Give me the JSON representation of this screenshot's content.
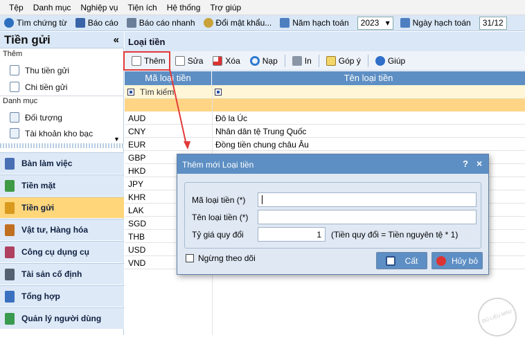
{
  "menu": [
    "Tệp",
    "Danh mục",
    "Nghiệp vụ",
    "Tiện ích",
    "Hệ thống",
    "Trợ giúp"
  ],
  "toolbar": {
    "items": [
      "Tìm chứng từ",
      "Báo cáo",
      "Báo cáo nhanh",
      "Đổi mật khẩu..."
    ],
    "year_label": "Năm hạch toán",
    "year_value": "2023",
    "date_label": "Ngày hạch toán",
    "date_value": "31/12"
  },
  "left": {
    "title": "Tiền gửi",
    "collapse": "«",
    "groups": [
      {
        "label": "Thêm",
        "items": [
          "Thu tiền gửi",
          "Chi tiền gửi"
        ]
      },
      {
        "label": "Danh mục",
        "items": [
          "Đối tượng",
          "Tài khoản kho bạc"
        ]
      }
    ],
    "modules": [
      {
        "label": "Bàn làm việc",
        "color": "#4a6fb5"
      },
      {
        "label": "Tiền mặt",
        "color": "#3f9a45"
      },
      {
        "label": "Tiền gửi",
        "color": "#d99a1e",
        "active": true
      },
      {
        "label": "Vật tư, Hàng hóa",
        "color": "#c07020"
      },
      {
        "label": "Công cụ dụng cụ",
        "color": "#b04060"
      },
      {
        "label": "Tài sản cố định",
        "color": "#556070"
      },
      {
        "label": "Tổng hợp",
        "color": "#3a70c0"
      },
      {
        "label": "Quản lý người dùng",
        "color": "#3a9a50"
      }
    ]
  },
  "main": {
    "title": "Loại tiền",
    "tools": [
      "Thêm",
      "Sửa",
      "Xóa",
      "Nạp",
      "In",
      "Góp ý",
      "Giúp"
    ],
    "columns": [
      "Mã loại tiền",
      "Tên loại tiền"
    ],
    "filter_label": "Tìm kiếm",
    "rows": [
      {
        "code": "AUD",
        "name": "Đô la Úc"
      },
      {
        "code": "CNY",
        "name": "Nhân dân tệ Trung Quốc"
      },
      {
        "code": "EUR",
        "name": "Đồng tiền chung châu Âu"
      },
      {
        "code": "GBP",
        "name": ""
      },
      {
        "code": "HKD",
        "name": ""
      },
      {
        "code": "JPY",
        "name": ""
      },
      {
        "code": "KHR",
        "name": ""
      },
      {
        "code": "LAK",
        "name": ""
      },
      {
        "code": "SGD",
        "name": ""
      },
      {
        "code": "THB",
        "name": ""
      },
      {
        "code": "USD",
        "name": ""
      },
      {
        "code": "VND",
        "name": ""
      }
    ]
  },
  "dialog": {
    "title": "Thêm mới Loại tiền",
    "help": "?",
    "close": "×",
    "code_label": "Mã loại tiền (*)",
    "name_label": "Tên loại tiền (*)",
    "rate_label": "Tỷ giá quy đổi",
    "rate_value": "1",
    "rate_note": "(Tiền quy đổi = Tiền nguyên tệ * 1)",
    "inactive_label": "Ngừng theo dõi",
    "save": "Cất",
    "cancel": "Hủy bỏ"
  },
  "watermark": "ĐỦ LIỆU MAU"
}
